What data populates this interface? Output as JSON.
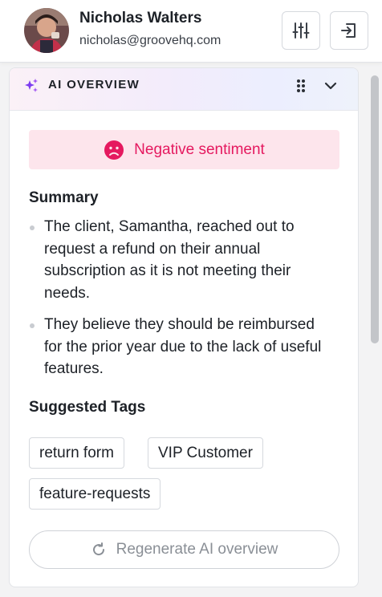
{
  "user": {
    "name": "Nicholas Walters",
    "email": "nicholas@groovehq.com"
  },
  "header": {
    "settings_icon": "sliders-icon",
    "logout_icon": "logout-icon"
  },
  "overview": {
    "title": "AI OVERVIEW",
    "sentiment": {
      "label": "Negative sentiment",
      "icon": "sad-face-icon",
      "color": "#e5195f",
      "background": "#fde5ec"
    },
    "summary_title": "Summary",
    "summary": [
      "The client, Samantha, reached out to request a refund on their annual subscription as it is not meeting their needs.",
      "They believe they should be reimbursed for the prior year due to the lack of useful features."
    ],
    "tags_title": "Suggested Tags",
    "tags": [
      "return form",
      "VIP Customer",
      "feature-requests"
    ],
    "regenerate_label": "Regenerate AI overview"
  }
}
